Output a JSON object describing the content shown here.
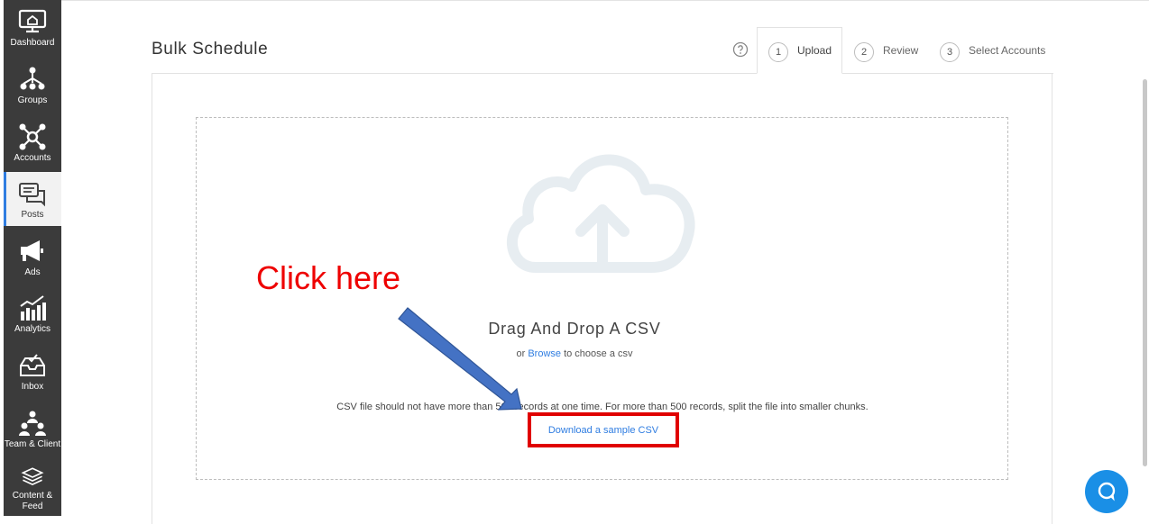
{
  "sidebar": {
    "items": [
      {
        "label": "Dashboard",
        "icon": "monitor-icon"
      },
      {
        "label": "Groups",
        "icon": "groups-icon"
      },
      {
        "label": "Accounts",
        "icon": "accounts-icon"
      },
      {
        "label": "Posts",
        "icon": "posts-icon",
        "active": true
      },
      {
        "label": "Ads",
        "icon": "megaphone-icon"
      },
      {
        "label": "Analytics",
        "icon": "analytics-icon"
      },
      {
        "label": "Inbox",
        "icon": "inbox-icon"
      },
      {
        "label": "Team & Client",
        "icon": "team-icon"
      },
      {
        "label": "Content & Feed",
        "icon": "content-icon"
      }
    ]
  },
  "header": {
    "title": "Bulk Schedule",
    "help_icon": "question-circle-icon"
  },
  "tabs": [
    {
      "num": "1",
      "label": "Upload",
      "active": true
    },
    {
      "num": "2",
      "label": "Review"
    },
    {
      "num": "3",
      "label": "Select Accounts"
    }
  ],
  "upload": {
    "icon": "cloud-upload-icon",
    "title": "Drag And Drop A CSV",
    "sub_prefix": "or",
    "browse_label": "Browse",
    "sub_suffix": "to choose a csv",
    "note": "CSV file should not have more than 500 records at one time. For more than 500 records, split the file into smaller chunks.",
    "download_label": "Download a sample CSV"
  },
  "annotation": {
    "text": "Click here",
    "color": "#ee0000",
    "arrow_color": "#4472c4"
  },
  "chat": {
    "icon": "chat-bubble-icon"
  },
  "colors": {
    "sidebar_bg": "#3b3b3b",
    "accent": "#2f7de1",
    "highlight": "#e00000",
    "chat": "#1a8fe6"
  }
}
